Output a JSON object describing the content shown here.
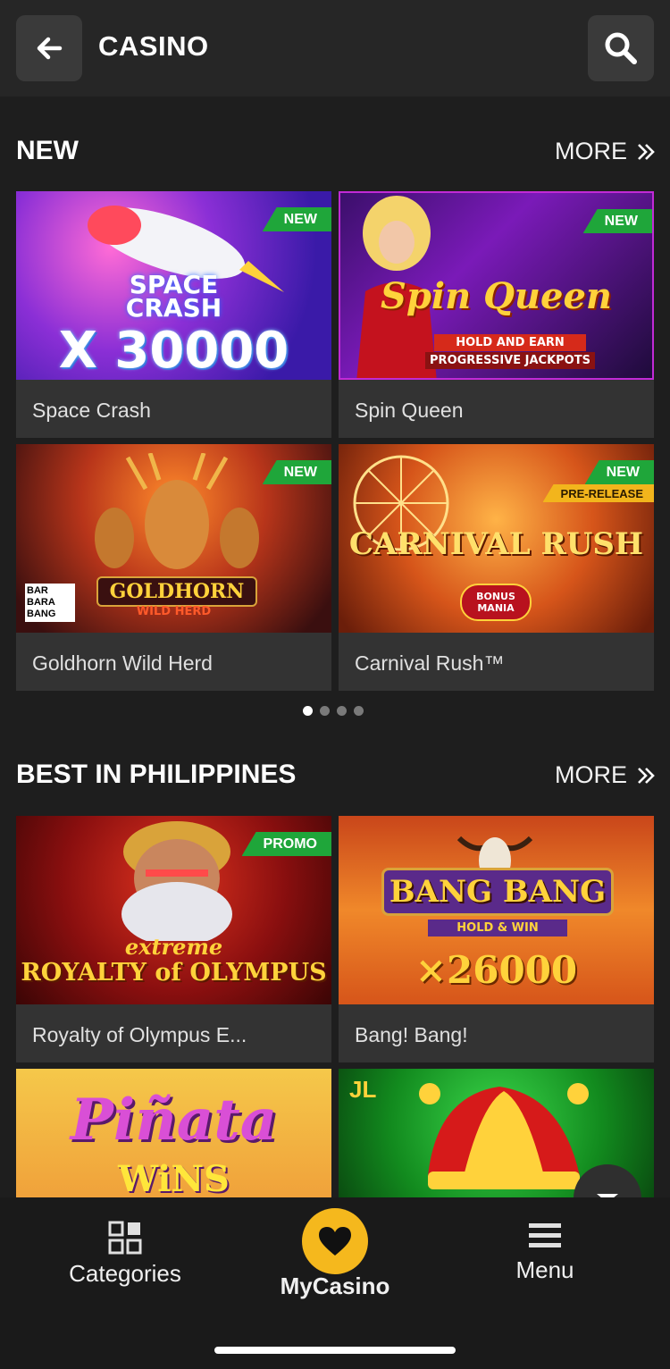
{
  "header": {
    "title": "CASINO",
    "back_icon": "arrow-left-icon",
    "search_icon": "search-icon"
  },
  "sections": [
    {
      "title": "NEW",
      "more_label": "MORE",
      "games": [
        {
          "name": "Space Crash",
          "badge": "NEW",
          "art_line1": "SPACE",
          "art_line2": "CRASH",
          "art_line3": "X 30000"
        },
        {
          "name": "Spin Queen",
          "badge": "NEW",
          "art_line1": "Spin Queen",
          "art_line2": "HOLD AND EARN",
          "art_line3": "PROGRESSIVE JACKPOTS"
        },
        {
          "name": "Goldhorn Wild Herd",
          "badge": "NEW",
          "art_line1": "GOLDHORN",
          "art_line2": "WILD HERD",
          "art_line3": "BAR BARA BANG"
        },
        {
          "name": "Carnival Rush™",
          "badge": "NEW",
          "badge2": "PRE-RELEASE",
          "art_line1": "CARNIVAL RUSH",
          "art_line2": "BONUS MANIA"
        }
      ],
      "pagination": {
        "pages": 4,
        "active": 1
      }
    },
    {
      "title": "BEST IN PHILIPPINES",
      "more_label": "MORE",
      "games": [
        {
          "name": "Royalty of Olympus E...",
          "badge": "PROMO",
          "art_line1": "extreme",
          "art_line2": "ROYALTY of OLYMPUS"
        },
        {
          "name": "Bang! Bang!",
          "art_line1": "BANG BANG",
          "art_line2": "HOLD & WIN",
          "art_line3": "×26000"
        },
        {
          "art_line1": "Piñata",
          "art_line2": "WiNS"
        },
        {
          "art_line1": "JL"
        }
      ]
    }
  ],
  "bottom_nav": {
    "categories": {
      "label": "Categories",
      "icon": "grid-icon"
    },
    "mycasino": {
      "label": "MyCasino",
      "icon": "heart-icon"
    },
    "menu": {
      "label": "Menu",
      "icon": "hamburger-icon"
    }
  },
  "colors": {
    "accent": "#f5b81d",
    "badge_green": "#1fa63a",
    "background": "#1e1e1e",
    "card": "#333333"
  }
}
